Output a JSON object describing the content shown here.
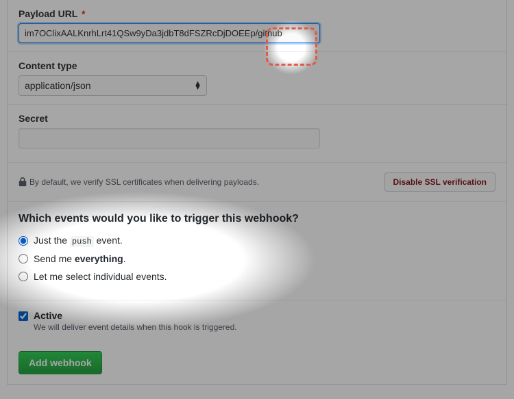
{
  "payload": {
    "label": "Payload URL",
    "required_mark": "*",
    "value": "im7OClixAALKnrhLrt41QSw9yDa3jdbT8dFSZRcDjDOEEp/github"
  },
  "content_type": {
    "label": "Content type",
    "selected": "application/json"
  },
  "secret": {
    "label": "Secret",
    "value": ""
  },
  "ssl": {
    "text": "By default, we verify SSL certificates when delivering payloads.",
    "disable_btn": "Disable SSL verification"
  },
  "events": {
    "title": "Which events would you like to trigger this webhook?",
    "options": {
      "push_pre": "Just the ",
      "push_code": "push",
      "push_post": " event.",
      "everything_pre": "Send me ",
      "everything_bold": "everything",
      "everything_post": ".",
      "individual": "Let me select individual events."
    }
  },
  "active": {
    "label": "Active",
    "desc": "We will deliver event details when this hook is triggered."
  },
  "submit": {
    "label": "Add webhook"
  }
}
